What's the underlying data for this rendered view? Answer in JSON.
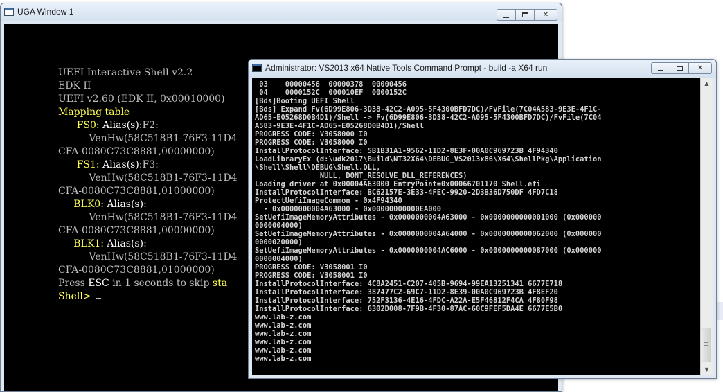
{
  "uga_window": {
    "title": "UGA Window 1",
    "lines": [
      [
        {
          "t": "UEFI Interactive Shell v2.2",
          "c": "c-gray"
        }
      ],
      [
        {
          "t": "EDK II",
          "c": "c-gray"
        }
      ],
      [
        {
          "t": "UEFI v2.60 (EDK II, 0x00010000)",
          "c": "c-gray"
        }
      ],
      [
        {
          "t": "Mapping table",
          "c": "c-yellow"
        }
      ],
      [
        {
          "t": "      FS0:",
          "c": "c-yellow"
        },
        {
          "t": " Alias(s)",
          "c": "c-white"
        },
        {
          "t": ":F2:",
          "c": "c-gray"
        }
      ],
      [
        {
          "t": "          VenHw(58C518B1-76F3-11D4",
          "c": "c-gray"
        }
      ],
      [
        {
          "t": "CFA-0080C73C8881,00000000)",
          "c": "c-gray"
        }
      ],
      [
        {
          "t": "      FS1:",
          "c": "c-yellow"
        },
        {
          "t": " Alias(s)",
          "c": "c-white"
        },
        {
          "t": ":F3:",
          "c": "c-gray"
        }
      ],
      [
        {
          "t": "          VenHw(58C518B1-76F3-11D4",
          "c": "c-gray"
        }
      ],
      [
        {
          "t": "CFA-0080C73C8881,01000000)",
          "c": "c-gray"
        }
      ],
      [
        {
          "t": "     BLK0:",
          "c": "c-yellow"
        },
        {
          "t": " Alias(s)",
          "c": "c-white"
        },
        {
          "t": ":",
          "c": "c-gray"
        }
      ],
      [
        {
          "t": "          VenHw(58C518B1-76F3-11D4",
          "c": "c-gray"
        }
      ],
      [
        {
          "t": "CFA-0080C73C8881,00000000)",
          "c": "c-gray"
        }
      ],
      [
        {
          "t": "     BLK1:",
          "c": "c-yellow"
        },
        {
          "t": " Alias(s)",
          "c": "c-white"
        },
        {
          "t": ":",
          "c": "c-gray"
        }
      ],
      [
        {
          "t": "          VenHw(58C518B1-76F3-11D4",
          "c": "c-gray"
        }
      ],
      [
        {
          "t": "CFA-0080C73C8881,01000000)",
          "c": "c-gray"
        }
      ],
      [
        {
          "t": "Press ",
          "c": "c-gray"
        },
        {
          "t": "ESC",
          "c": "c-white"
        },
        {
          "t": " in 1 seconds to skip ",
          "c": "c-gray"
        },
        {
          "t": "sta",
          "c": "c-yellow"
        }
      ],
      [
        {
          "t": "Shell> ",
          "c": "c-yellow"
        }
      ]
    ]
  },
  "cmd_window": {
    "title": "Administrator: VS2013 x64 Native Tools Command Prompt - build  -a X64 run",
    "lines": [
      " 03    00000456  00000378  00000456",
      " 04    0000152C  000010EF  0000152C",
      "[Bds]Booting UEFI Shell",
      "[Bds] Expand Fv(6D99E806-3D38-42C2-A095-5F4300BFD7DC)/FvFile(7C04A583-9E3E-4F1C-",
      "AD65-E05268D0B4D1)/Shell -> Fv(6D99E806-3D38-42C2-A095-5F4300BFD7DC)/FvFile(7C04",
      "A583-9E3E-4F1C-AD65-E05268D0B4D1)/Shell",
      "PROGRESS CODE: V3058000 I0",
      "PROGRESS CODE: V3058000 I0",
      "InstallProtocolInterface: 5B1B31A1-9562-11D2-8E3F-00A0C969723B 4F94340",
      "LoadLibraryEx (d:\\udk2017\\Build\\NT32X64\\DEBUG_VS2013x86\\X64\\ShellPkg\\Application",
      "\\Shell\\Shell\\DEBUG\\Shell.DLL,",
      "               NULL, DONT_RESOLVE_DLL_REFERENCES)",
      "Loading driver at 0x00004A63000 EntryPoint=0x00066701170 Shell.efi",
      "InstallProtocolInterface: BC62157E-3E33-4FEC-9920-2D3B36D750DF 4FD7C18",
      "ProtectUefiImageCommon - 0x4F94340",
      "  - 0x0000000004A63000 - 0x00000000000EA000",
      "SetUefiImageMemoryAttributes - 0x0000000004A63000 - 0x0000000000001000 (0x000000",
      "0000004000)",
      "SetUefiImageMemoryAttributes - 0x0000000004A64000 - 0x0000000000062000 (0x000000",
      "0000020000)",
      "SetUefiImageMemoryAttributes - 0x0000000004AC6000 - 0x0000000000087000 (0x000000",
      "0000004000)",
      "PROGRESS CODE: V3058001 I0",
      "PROGRESS CODE: V3058001 I0",
      "InstallProtocolInterface: 4C8A2451-C207-405B-9694-99EA13251341 6677E718",
      "InstallProtocolInterface: 387477C2-69C7-11D2-8E39-00A0C969723B 4F8EF20",
      "InstallProtocolInterface: 752F3136-4E16-4FDC-A22A-E5F46812F4CA 4F80F98",
      "InstallProtocolInterface: 6302D008-7F9B-4F30-87AC-60C9FEF5DA4E 6677E5B0",
      "www.lab-z.com",
      "www.lab-z.com",
      "www.lab-z.com",
      "www.lab-z.com",
      "www.lab-z.com",
      "www.lab-z.com"
    ]
  },
  "icons": {
    "minimize": "minimize-icon",
    "maximize": "maximize-icon",
    "close": "close-icon",
    "scroll_up": "scroll-up-icon",
    "scroll_down": "scroll-down-icon"
  },
  "glyphs": {
    "close": "✕",
    "up": "▲",
    "down": "▼"
  }
}
